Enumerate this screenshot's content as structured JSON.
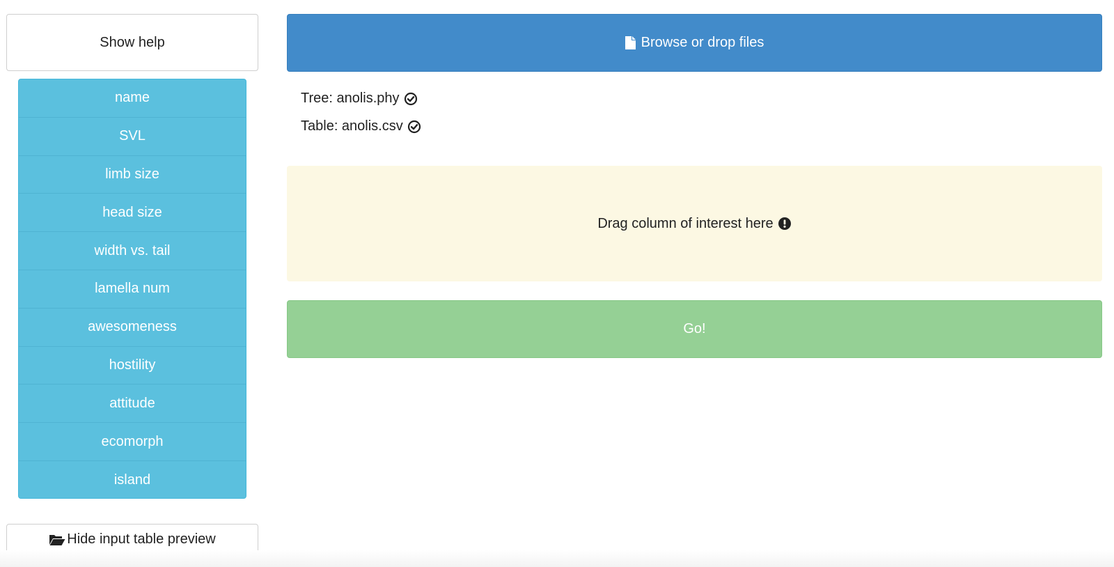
{
  "sidebar": {
    "help_button": "Show help",
    "columns": [
      "name",
      "SVL",
      "limb size",
      "head size",
      "width vs. tail",
      "lamella num",
      "awesomeness",
      "hostility",
      "attitude",
      "ecomorph",
      "island"
    ],
    "hide_preview_button": "Hide input table preview",
    "hide_preview_icon": "folder-open-icon"
  },
  "main": {
    "browse_button": "Browse or drop files",
    "browse_icon": "file-icon",
    "files": {
      "tree": "Tree: anolis.phy",
      "table": "Table: anolis.csv",
      "status_icon": "check-circle-icon"
    },
    "dropzone": {
      "label": "Drag column of interest here",
      "icon": "exclamation-circle-icon"
    },
    "go_button": "Go!"
  },
  "colors": {
    "primary": "#428bca",
    "info": "#5bc0de",
    "warning_bg": "#fcf8e3",
    "success": "#95d095"
  }
}
